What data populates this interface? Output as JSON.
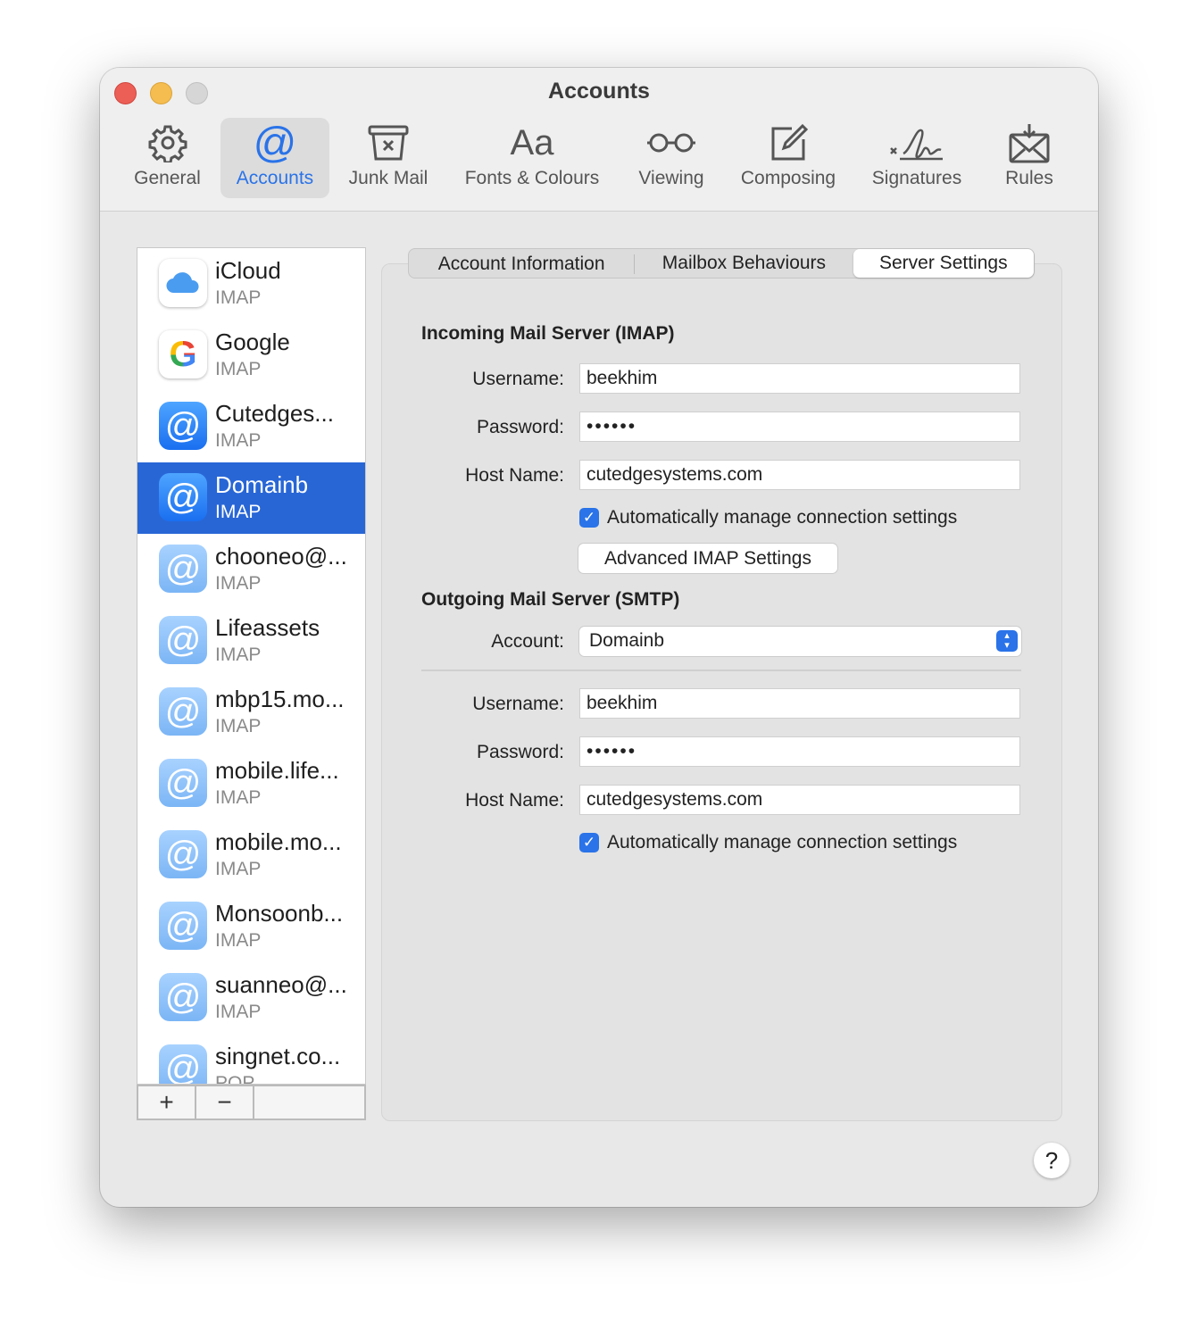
{
  "window": {
    "title": "Accounts"
  },
  "toolbar": [
    {
      "label": "General",
      "icon": "gear-icon"
    },
    {
      "label": "Accounts",
      "icon": "at-icon"
    },
    {
      "label": "Junk Mail",
      "icon": "junk-bin-icon"
    },
    {
      "label": "Fonts & Colours",
      "icon": "fonts-icon",
      "glyph": "Aa"
    },
    {
      "label": "Viewing",
      "icon": "glasses-icon"
    },
    {
      "label": "Composing",
      "icon": "compose-icon"
    },
    {
      "label": "Signatures",
      "icon": "signature-icon"
    },
    {
      "label": "Rules",
      "icon": "rules-icon"
    }
  ],
  "accounts": [
    {
      "name": "iCloud",
      "type": "IMAP"
    },
    {
      "name": "Google",
      "type": "IMAP"
    },
    {
      "name": "Cutedges...",
      "type": "IMAP"
    },
    {
      "name": "Domainb",
      "type": "IMAP"
    },
    {
      "name": "chooneo@...",
      "type": "IMAP"
    },
    {
      "name": "Lifeassets",
      "type": "IMAP"
    },
    {
      "name": "mbp15.mo...",
      "type": "IMAP"
    },
    {
      "name": "mobile.life...",
      "type": "IMAP"
    },
    {
      "name": "mobile.mo...",
      "type": "IMAP"
    },
    {
      "name": "Monsoonb...",
      "type": "IMAP"
    },
    {
      "name": "suanneo@...",
      "type": "IMAP"
    },
    {
      "name": "singnet.co...",
      "type": "POP"
    }
  ],
  "list_buttons": {
    "add": "+",
    "remove": "−"
  },
  "tabs": [
    "Account Information",
    "Mailbox Behaviours",
    "Server Settings"
  ],
  "incoming": {
    "heading": "Incoming Mail Server (IMAP)",
    "username_label": "Username:",
    "username": "beekhim",
    "password_label": "Password:",
    "password": "••••••",
    "host_label": "Host Name:",
    "host": "cutedgesystems.com",
    "auto_label": "Automatically manage connection settings",
    "advanced_button": "Advanced IMAP Settings"
  },
  "outgoing": {
    "heading": "Outgoing Mail Server (SMTP)",
    "account_label": "Account:",
    "account": "Domainb",
    "username_label": "Username:",
    "username": "beekhim",
    "password_label": "Password:",
    "password": "••••••",
    "host_label": "Host Name:",
    "host": "cutedgesystems.com",
    "auto_label": "Automatically manage connection settings"
  },
  "help": "?"
}
